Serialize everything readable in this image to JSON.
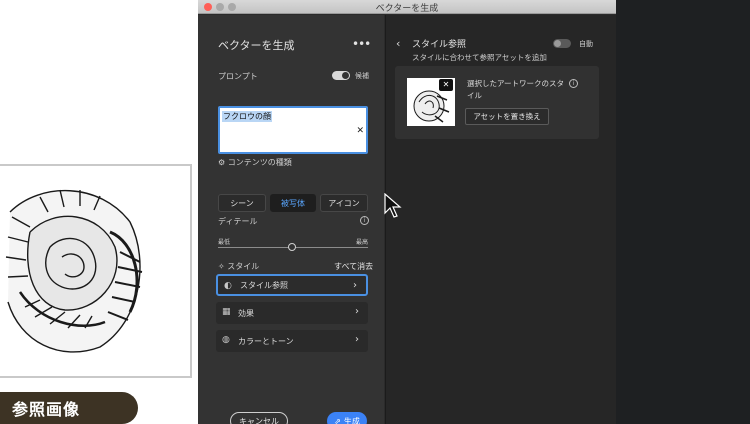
{
  "window": {
    "title": "ベクターを生成"
  },
  "left_panel": {
    "title": "ベクターを生成",
    "more_icon": "more-horizontal-icon",
    "prompt": {
      "label": "プロンプト",
      "suggestion_label": "候補",
      "suggestion_enabled": true,
      "value": "フクロウの顔"
    },
    "content_type": {
      "label": "コンテンツの種類",
      "options": [
        "シーン",
        "被写体",
        "アイコン"
      ],
      "selected": "被写体"
    },
    "detail": {
      "label": "ディテール",
      "min_label": "最低",
      "max_label": "最高",
      "value_fraction": 0.5
    },
    "style": {
      "label": "スタイル",
      "clear_all": "すべて消去",
      "items": [
        {
          "label": "スタイル参照",
          "icon": "style-reference-icon",
          "active": true
        },
        {
          "label": "効果",
          "icon": "effects-icon",
          "active": false
        },
        {
          "label": "カラーとトーン",
          "icon": "color-tone-icon",
          "active": false
        }
      ]
    },
    "cancel_label": "キャンセル",
    "generate_label": "生成"
  },
  "right_panel": {
    "title": "スタイル参照",
    "subtitle": "スタイルに合わせて参照アセットを追加",
    "auto_label": "自動",
    "auto_enabled": false,
    "selected_artwork_text": "選択したアートワークのスタイル",
    "replace_asset_label": "アセットを置き換え"
  },
  "canvas": {
    "reference_label": "参照画像"
  },
  "colors": {
    "accent": "#3b82f6",
    "panel": "#333333",
    "banner": "#3d3324"
  }
}
